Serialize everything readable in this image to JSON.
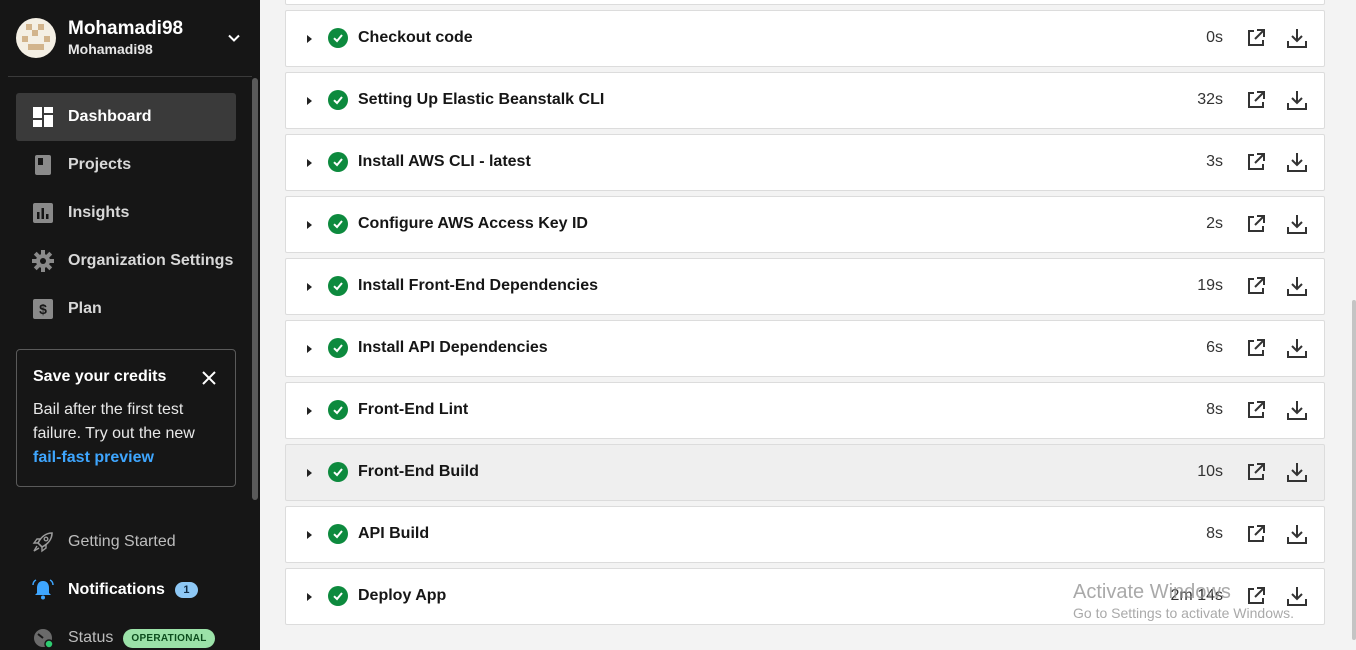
{
  "user": {
    "name": "Mohamadi98",
    "org": "Mohamadi98"
  },
  "nav": [
    {
      "label": "Dashboard",
      "icon": "dashboard-icon",
      "active": true
    },
    {
      "label": "Projects",
      "icon": "projects-icon"
    },
    {
      "label": "Insights",
      "icon": "insights-icon"
    },
    {
      "label": "Organization Settings",
      "icon": "gear-icon"
    },
    {
      "label": "Plan",
      "icon": "dollar-icon"
    }
  ],
  "credits": {
    "title": "Save your credits",
    "body": "Bail after the first test failure. Try out the new",
    "link": "fail-fast preview"
  },
  "bottom": {
    "getting_started": "Getting Started",
    "notifications": "Notifications",
    "notification_count": "1",
    "status": "Status",
    "status_badge": "OPERATIONAL"
  },
  "steps": [
    {
      "label": "Checkout code",
      "duration": "0s",
      "status": "success"
    },
    {
      "label": "Setting Up Elastic Beanstalk CLI",
      "duration": "32s",
      "status": "success"
    },
    {
      "label": "Install AWS CLI - latest",
      "duration": "3s",
      "status": "success"
    },
    {
      "label": "Configure AWS Access Key ID",
      "duration": "2s",
      "status": "success"
    },
    {
      "label": "Install Front-End Dependencies",
      "duration": "19s",
      "status": "success"
    },
    {
      "label": "Install API Dependencies",
      "duration": "6s",
      "status": "success"
    },
    {
      "label": "Front-End Lint",
      "duration": "8s",
      "status": "success"
    },
    {
      "label": "Front-End Build",
      "duration": "10s",
      "status": "success"
    },
    {
      "label": "API Build",
      "duration": "8s",
      "status": "success"
    },
    {
      "label": "Deploy App",
      "duration": "2m 14s",
      "status": "success"
    }
  ],
  "watermark": {
    "line1": "Activate Windows",
    "line2": "Go to Settings to activate Windows."
  },
  "colors": {
    "success": "#0d8a3e",
    "link": "#3ea6ff",
    "sidebar_bg": "#161616"
  }
}
